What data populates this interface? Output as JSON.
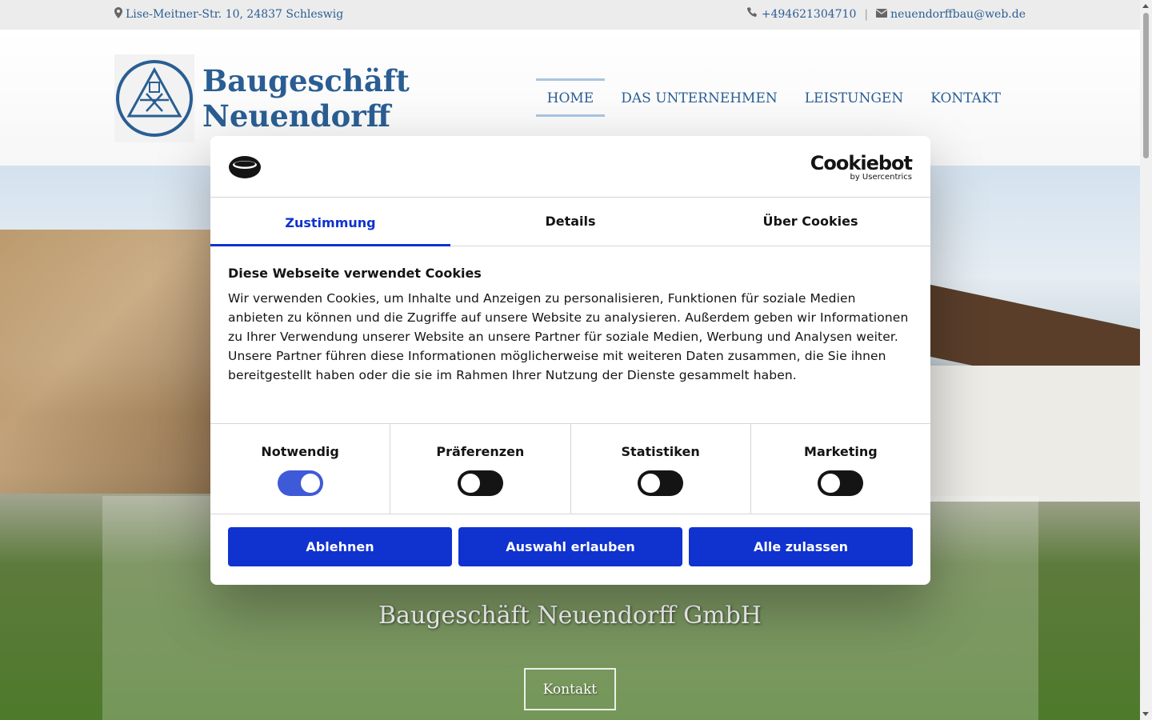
{
  "topbar": {
    "address": "Lise-Meitner-Str. 10, 24837 Schleswig",
    "phone": "+494621304710",
    "separator": "|",
    "email": "neuendorffbau@web.de"
  },
  "header": {
    "logo_line1": "Baugeschäft",
    "logo_line2": "Neuendorff",
    "nav": [
      {
        "label": "HOME",
        "active": true
      },
      {
        "label": "DAS UNTERNEHMEN"
      },
      {
        "label": "LEISTUNGEN"
      },
      {
        "label": "KONTAKT"
      }
    ]
  },
  "hero": {
    "title": "Baugeschäft Neuendorff GmbH",
    "cta": "Kontakt"
  },
  "cookie": {
    "brand": "Cookiebot",
    "brand_sub": "by Usercentrics",
    "tabs": [
      "Zustimmung",
      "Details",
      "Über Cookies"
    ],
    "heading": "Diese Webseite verwendet Cookies",
    "text": "Wir verwenden Cookies, um Inhalte und Anzeigen zu personalisieren, Funktionen für soziale Medien anbieten zu können und die Zugriffe auf unsere Website zu analysieren. Außerdem geben wir Informationen zu Ihrer Verwendung unserer Website an unsere Partner für soziale Medien, Werbung und Analysen weiter. Unsere Partner führen diese Informationen möglicherweise mit weiteren Daten zusammen, die Sie ihnen bereitgestellt haben oder die sie im Rahmen Ihrer Nutzung der Dienste gesammelt haben.",
    "categories": [
      {
        "label": "Notwendig",
        "checked": true
      },
      {
        "label": "Präferenzen",
        "checked": false
      },
      {
        "label": "Statistiken",
        "checked": false
      },
      {
        "label": "Marketing",
        "checked": false
      }
    ],
    "buttons": [
      "Ablehnen",
      "Auswahl erlauben",
      "Alle zulassen"
    ]
  },
  "colors": {
    "brand_blue": "#2a5e93",
    "cookie_blue": "#1032cf"
  }
}
